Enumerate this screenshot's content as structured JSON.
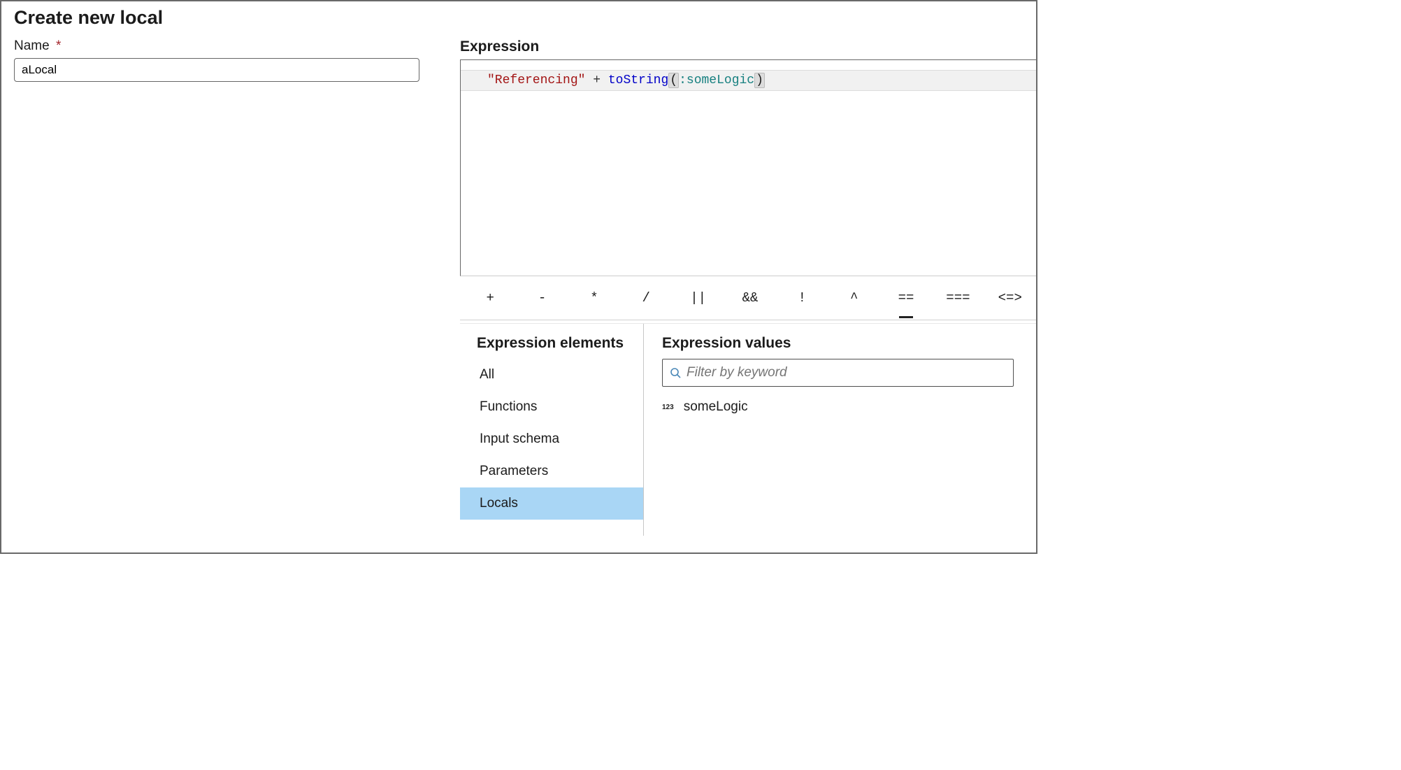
{
  "page": {
    "title": "Create new local"
  },
  "name_field": {
    "label": "Name",
    "required_mark": "*",
    "value": "aLocal"
  },
  "expression": {
    "label": "Expression",
    "tokens": {
      "string": "\"Referencing\"",
      "plus": " + ",
      "func": "toString",
      "lparen": "(",
      "colon": ":",
      "ident": "someLogic",
      "rparen": ")"
    }
  },
  "operators": [
    "+",
    "-",
    "*",
    "/",
    "||",
    "&&",
    "!",
    "^",
    "==",
    "===",
    "<=>"
  ],
  "elements_panel": {
    "title": "Expression elements",
    "items": [
      "All",
      "Functions",
      "Input schema",
      "Parameters",
      "Locals"
    ],
    "selected": "Locals"
  },
  "values_panel": {
    "title": "Expression values",
    "filter_placeholder": "Filter by keyword",
    "items": [
      {
        "type_badge": "123",
        "label": "someLogic"
      }
    ]
  }
}
